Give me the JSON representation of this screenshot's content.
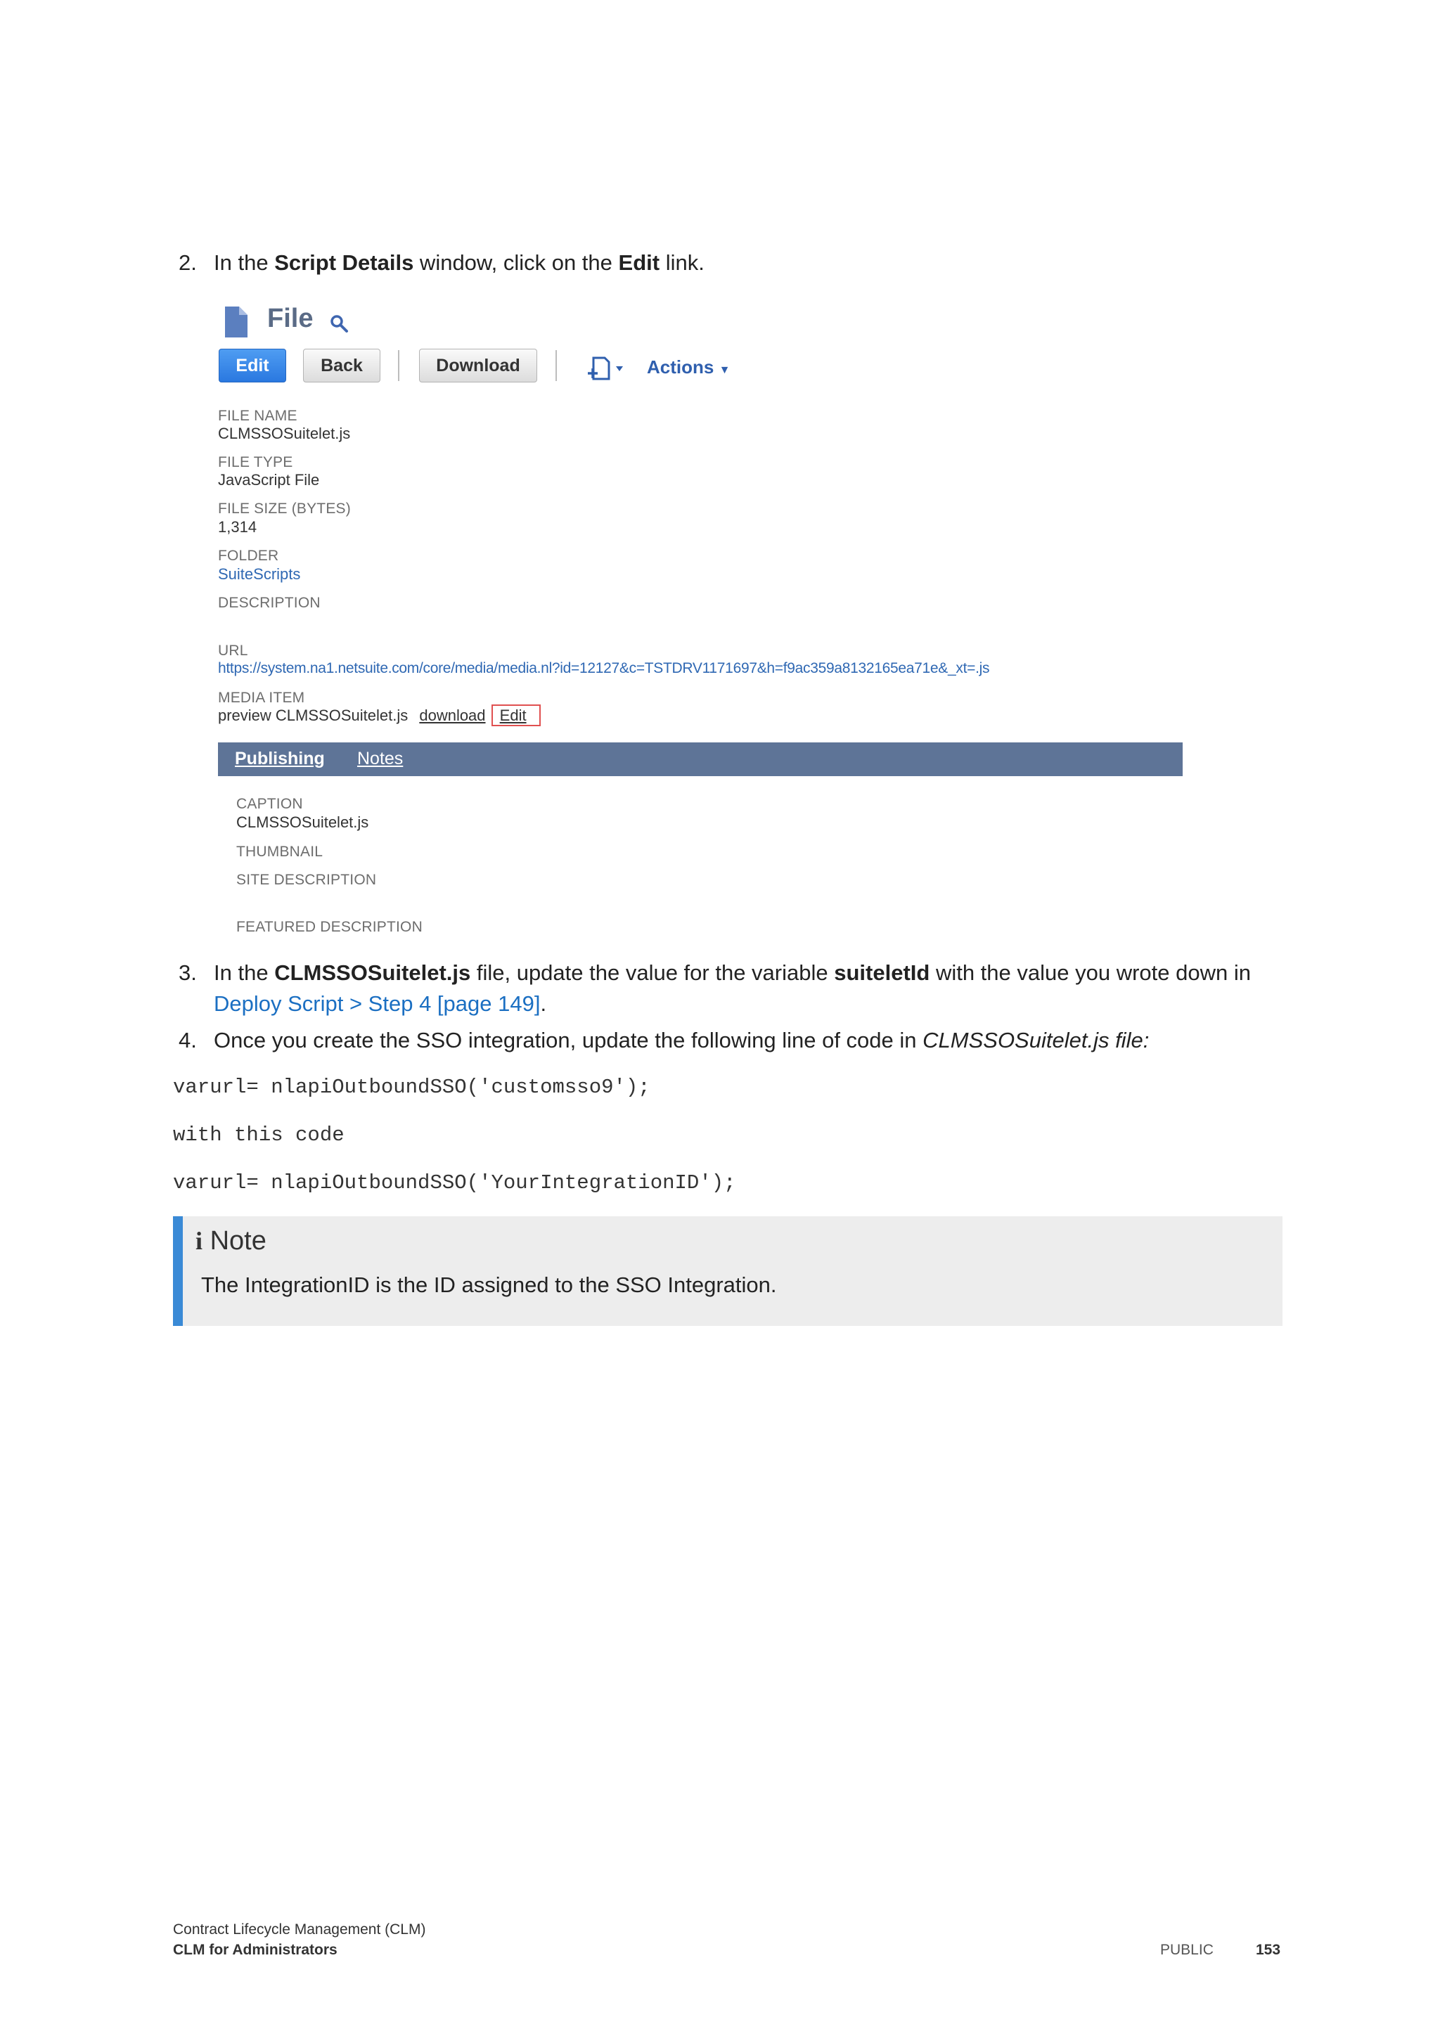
{
  "steps": {
    "step2": {
      "num": "2.",
      "pre": "In the ",
      "bold1": "Script Details",
      "mid": " window, click on the ",
      "bold2": "Edit",
      "post": " link."
    },
    "step3": {
      "num": "3.",
      "pre": "In the ",
      "bold1": "CLMSSOSuitelet.js",
      "mid": " file, update the value for the variable ",
      "bold2": "suiteletId",
      "post": " with the value you wrote down in",
      "link": "Deploy Script > Step 4 [page 149]",
      "end": "."
    },
    "step4": {
      "num": "4.",
      "pre": "Once you create the SSO integration, update the following line of code in ",
      "italic": "CLMSSOSuitelet.js file:"
    }
  },
  "screenshot": {
    "title": "File",
    "buttons": {
      "edit": "Edit",
      "back": "Back",
      "download": "Download",
      "actions": "Actions"
    },
    "fields": {
      "file_name_label": "FILE NAME",
      "file_name": "CLMSSOSuitelet.js",
      "file_type_label": "FILE TYPE",
      "file_type": "JavaScript File",
      "file_size_label": "FILE SIZE (BYTES)",
      "file_size": "1,314",
      "folder_label": "FOLDER",
      "folder": "SuiteScripts",
      "description_label": "DESCRIPTION",
      "url_label": "URL",
      "url": "https://system.na1.netsuite.com/core/media/media.nl?id=12127&c=TSTDRV1171697&h=f9ac359a8132165ea71e&_xt=.js",
      "media_item_label": "MEDIA ITEM",
      "media_preview": "preview CLMSSOSuitelet.js",
      "media_download": "download",
      "media_edit": "Edit"
    },
    "tabs": {
      "publishing": "Publishing",
      "notes": "Notes"
    },
    "publishing": {
      "caption_label": "CAPTION",
      "caption": "CLMSSOSuitelet.js",
      "thumbnail_label": "THUMBNAIL",
      "site_description_label": "SITE DESCRIPTION",
      "featured_description_label": "FEATURED DESCRIPTION"
    }
  },
  "code": {
    "line1": "varurl= nlapiOutboundSSO('customsso9');",
    "line2": "with this code",
    "line3": "varurl= nlapiOutboundSSO('YourIntegrationID');"
  },
  "note": {
    "icon": "i",
    "title": "Note",
    "text": "The IntegrationID is the ID assigned to the SSO Integration."
  },
  "footer": {
    "line1": "Contract Lifecycle Management (CLM)",
    "line2": "CLM for Administrators",
    "classification": "PUBLIC",
    "page": "153"
  },
  "colors": {
    "link": "#1b6fc2",
    "tab_bar": "#5e7497",
    "note_accent": "#3a8ad6",
    "edit_highlight": "#e05050"
  }
}
